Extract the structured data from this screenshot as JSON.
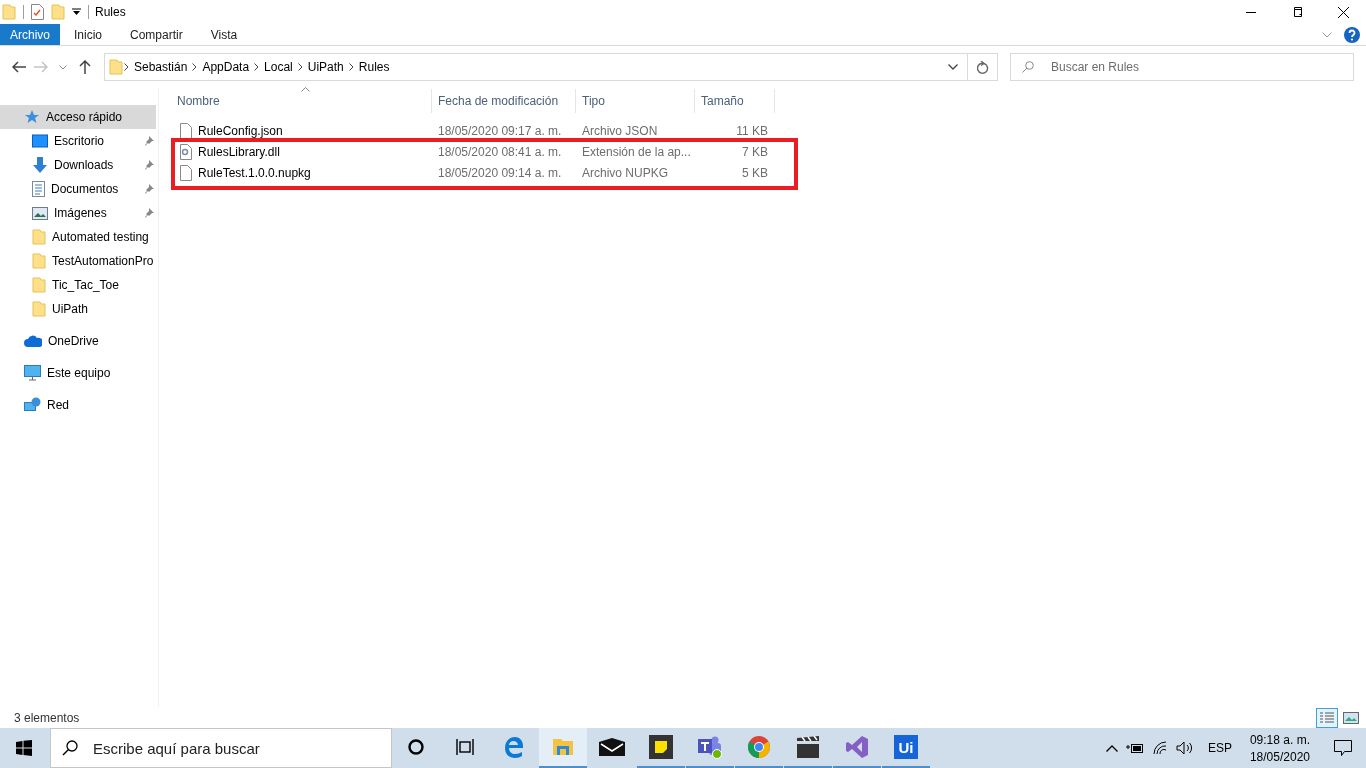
{
  "window": {
    "title": "Rules"
  },
  "ribbon_tabs": [
    {
      "label": "Archivo",
      "selected": true
    },
    {
      "label": "Inicio",
      "selected": false
    },
    {
      "label": "Compartir",
      "selected": false
    },
    {
      "label": "Vista",
      "selected": false
    }
  ],
  "address": {
    "path": [
      "Sebastián",
      "AppData",
      "Local",
      "UiPath",
      "Rules"
    ]
  },
  "search": {
    "placeholder": "Buscar en Rules"
  },
  "sidebar": {
    "items": [
      {
        "label": "Acceso rápido",
        "kind": "quick",
        "selected": true,
        "children": [
          {
            "label": "Escritorio",
            "kind": "desktop",
            "pinned": true,
            "selected": false
          },
          {
            "label": "Downloads",
            "kind": "downloads",
            "pinned": true,
            "selected": false
          },
          {
            "label": "Documentos",
            "kind": "documents",
            "pinned": true,
            "selected": false
          },
          {
            "label": "Imágenes",
            "kind": "pictures",
            "pinned": true,
            "selected": false
          },
          {
            "label": "Automated testing",
            "kind": "folder",
            "pinned": false,
            "selected": false
          },
          {
            "label": "TestAutomationPro",
            "kind": "folder",
            "pinned": false,
            "selected": false
          },
          {
            "label": "Tic_Tac_Toe",
            "kind": "folder",
            "pinned": false,
            "selected": false
          },
          {
            "label": "UiPath",
            "kind": "folder",
            "pinned": false,
            "selected": false
          }
        ]
      },
      {
        "label": "OneDrive",
        "kind": "onedrive",
        "selected": false
      },
      {
        "label": "Este equipo",
        "kind": "pc",
        "selected": false
      },
      {
        "label": "Red",
        "kind": "network",
        "selected": false
      }
    ]
  },
  "table": {
    "columns": [
      {
        "label": "Nombre",
        "sorted": true
      },
      {
        "label": "Fecha de modificación",
        "sorted": false
      },
      {
        "label": "Tipo",
        "sorted": false
      },
      {
        "label": "Tamaño",
        "sorted": false
      }
    ],
    "rows": [
      {
        "name": "RuleConfig.json",
        "date": "18/05/2020 09:17 a. m.",
        "type": "Archivo JSON",
        "size": "11 KB",
        "kind": "file",
        "highlighted": false
      },
      {
        "name": "RulesLibrary.dll",
        "date": "18/05/2020 08:41 a. m.",
        "type": "Extensión de la ap...",
        "size": "7 KB",
        "kind": "library",
        "highlighted": true
      },
      {
        "name": "RuleTest.1.0.0.nupkg",
        "date": "18/05/2020 09:14 a. m.",
        "type": "Archivo NUPKG",
        "size": "5 KB",
        "kind": "file",
        "highlighted": true
      }
    ]
  },
  "status_bar": {
    "count": "3 elementos",
    "views": [
      {
        "kind": "details",
        "selected": true
      },
      {
        "kind": "large_icons",
        "selected": false
      }
    ]
  },
  "taskbar": {
    "search_placeholder": "Escribe aquí para buscar",
    "apps": [
      {
        "kind": "cortana",
        "running": false,
        "selected": false
      },
      {
        "kind": "taskview",
        "running": false,
        "selected": false
      },
      {
        "kind": "edge",
        "running": false,
        "selected": false
      },
      {
        "kind": "explorer",
        "running": true,
        "selected": true
      },
      {
        "kind": "mail",
        "running": false,
        "selected": false
      },
      {
        "kind": "notes",
        "running": true,
        "selected": false
      },
      {
        "kind": "teams",
        "running": true,
        "selected": false
      },
      {
        "kind": "chrome",
        "running": true,
        "selected": false
      },
      {
        "kind": "clapper",
        "running": true,
        "selected": false
      },
      {
        "kind": "vs",
        "running": true,
        "selected": false
      },
      {
        "kind": "uipath",
        "running": true,
        "selected": false,
        "label": "Ui"
      }
    ],
    "tray": {
      "language": "ESP",
      "time": "09:18 a. m.",
      "date": "18/05/2020"
    }
  }
}
